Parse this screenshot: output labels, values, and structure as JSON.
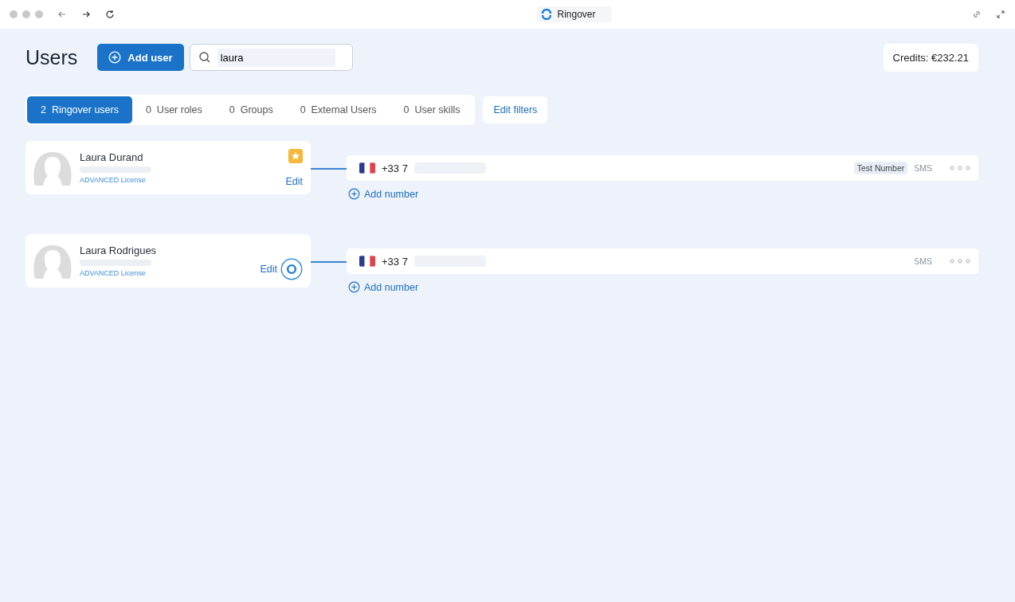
{
  "browser": {
    "tab_title": "Ringover"
  },
  "header": {
    "title": "Users",
    "add_button": "Add user",
    "search": {
      "value": "laura"
    },
    "credits": "Credits: €232.21"
  },
  "tabs": [
    {
      "count": "2",
      "label": "Ringover users",
      "selected": true
    },
    {
      "count": "0",
      "label": "User roles",
      "selected": false
    },
    {
      "count": "0",
      "label": "Groups",
      "selected": false
    },
    {
      "count": "0",
      "label": "External Users",
      "selected": false
    },
    {
      "count": "0",
      "label": "User skills",
      "selected": false
    }
  ],
  "edit_filters": "Edit filters",
  "users": [
    {
      "name": "Laura Durand",
      "license": "ADVANCED License",
      "starred": true,
      "edit": "Edit",
      "cursor": false,
      "number": {
        "prefix": "+33 7",
        "tag": "Test Number",
        "sms": "SMS"
      },
      "add_number": "Add number"
    },
    {
      "name": "Laura Rodrigues",
      "license": "ADVANCED License",
      "starred": false,
      "edit": "Edit",
      "cursor": true,
      "number": {
        "prefix": "+33 7",
        "sms": "SMS"
      },
      "add_number": "Add number"
    }
  ]
}
